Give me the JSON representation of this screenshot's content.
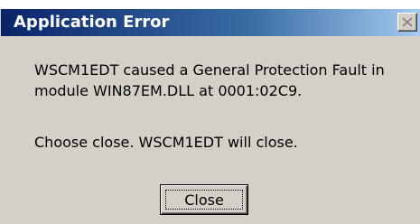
{
  "window": {
    "title": "Application Error",
    "close_icon": "close-x-icon"
  },
  "message": {
    "line1": "WSCM1EDT caused a General Protection Fault in module WIN87EM.DLL at 0001:02C9.",
    "line2": "Choose close. WSCM1EDT will close."
  },
  "buttons": {
    "close_label": "Close"
  },
  "colors": {
    "titlebar_start": "#0a246a",
    "titlebar_end": "#a6caf0",
    "dialog_bg": "#d4d0c8"
  }
}
